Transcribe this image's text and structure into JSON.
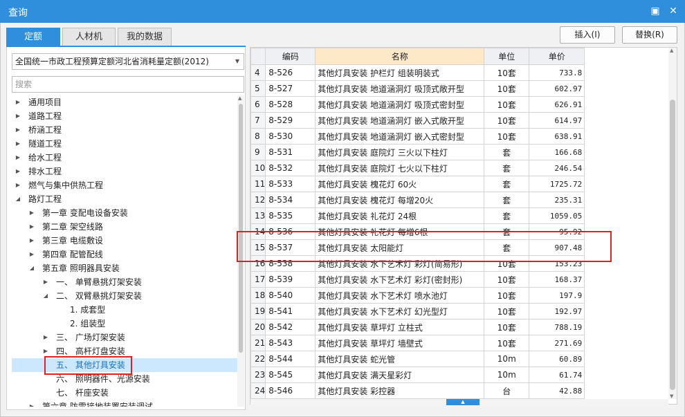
{
  "window": {
    "title": "查询",
    "restore_icon": "restore-icon",
    "close_icon": "close-icon"
  },
  "tabs": [
    {
      "label": "定额",
      "active": true
    },
    {
      "label": "人材机",
      "active": false
    },
    {
      "label": "我的数据",
      "active": false
    }
  ],
  "actions": {
    "insert_label": "插入(I)",
    "replace_label": "替换(R)"
  },
  "left": {
    "quota_select_value": "全国统一市政工程预算定额河北省消耗量定额(2012)",
    "search_placeholder": "搜索",
    "tree": [
      {
        "label": "通用项目",
        "level": 0,
        "state": "collapsed"
      },
      {
        "label": "道路工程",
        "level": 0,
        "state": "collapsed"
      },
      {
        "label": "桥涵工程",
        "level": 0,
        "state": "collapsed"
      },
      {
        "label": "隧道工程",
        "level": 0,
        "state": "collapsed"
      },
      {
        "label": "给水工程",
        "level": 0,
        "state": "collapsed"
      },
      {
        "label": "排水工程",
        "level": 0,
        "state": "collapsed"
      },
      {
        "label": "燃气与集中供热工程",
        "level": 0,
        "state": "collapsed"
      },
      {
        "label": "路灯工程",
        "level": 0,
        "state": "expanded"
      },
      {
        "label": "第一章 变配电设备安装",
        "level": 1,
        "state": "collapsed"
      },
      {
        "label": "第二章 架空线路",
        "level": 1,
        "state": "collapsed"
      },
      {
        "label": "第三章 电缆敷设",
        "level": 1,
        "state": "collapsed"
      },
      {
        "label": "第四章 配管配线",
        "level": 1,
        "state": "collapsed"
      },
      {
        "label": "第五章 照明器具安装",
        "level": 1,
        "state": "expanded"
      },
      {
        "label": "一、 单臂悬挑灯架安装",
        "level": 2,
        "state": "collapsed"
      },
      {
        "label": "二、 双臂悬挑灯架安装",
        "level": 2,
        "state": "expanded"
      },
      {
        "label": "1. 成套型",
        "level": 3,
        "state": "leaf"
      },
      {
        "label": "2. 组装型",
        "level": 3,
        "state": "leaf"
      },
      {
        "label": "三、 广场灯架安装",
        "level": 2,
        "state": "collapsed"
      },
      {
        "label": "四、 高杆灯盘安装",
        "level": 2,
        "state": "collapsed"
      },
      {
        "label": "五、 其他灯具安装",
        "level": 2,
        "state": "leaf",
        "selected": true
      },
      {
        "label": "六、 照明器件、光源安装",
        "level": 2,
        "state": "leaf"
      },
      {
        "label": "七、 杆座安装",
        "level": 2,
        "state": "leaf"
      },
      {
        "label": "第六章 防雷接地装置安装调试",
        "level": 1,
        "state": "collapsed"
      }
    ]
  },
  "grid": {
    "headers": {
      "num": "",
      "code": "编码",
      "name": "名称",
      "unit": "单位",
      "price": "单价"
    },
    "rows": [
      {
        "num": "4",
        "code": "8-526",
        "name": "其他灯具安装 护栏灯 组装明装式",
        "unit": "10套",
        "price": "733.8"
      },
      {
        "num": "5",
        "code": "8-527",
        "name": "其他灯具安装 地道涵洞灯 吸顶式敞开型",
        "unit": "10套",
        "price": "602.97"
      },
      {
        "num": "6",
        "code": "8-528",
        "name": "其他灯具安装 地道涵洞灯 吸顶式密封型",
        "unit": "10套",
        "price": "626.91"
      },
      {
        "num": "7",
        "code": "8-529",
        "name": "其他灯具安装 地道涵洞灯 嵌入式敞开型",
        "unit": "10套",
        "price": "614.97"
      },
      {
        "num": "8",
        "code": "8-530",
        "name": "其他灯具安装 地道涵洞灯 嵌入式密封型",
        "unit": "10套",
        "price": "638.91"
      },
      {
        "num": "9",
        "code": "8-531",
        "name": "其他灯具安装 庭院灯 三火以下柱灯",
        "unit": "套",
        "price": "166.68"
      },
      {
        "num": "10",
        "code": "8-532",
        "name": "其他灯具安装 庭院灯 七火以下柱灯",
        "unit": "套",
        "price": "246.54"
      },
      {
        "num": "11",
        "code": "8-533",
        "name": "其他灯具安装 槐花灯 60火",
        "unit": "套",
        "price": "1725.72"
      },
      {
        "num": "12",
        "code": "8-534",
        "name": "其他灯具安装 槐花灯 每增20火",
        "unit": "套",
        "price": "235.31"
      },
      {
        "num": "13",
        "code": "8-535",
        "name": "其他灯具安装 礼花灯 24根",
        "unit": "套",
        "price": "1059.05"
      },
      {
        "num": "14",
        "code": "8-536",
        "name": "其他灯具安装 礼花灯 每增6根",
        "unit": "套",
        "price": "95.92"
      },
      {
        "num": "15",
        "code": "8-537",
        "name": "其他灯具安装 太阳能灯",
        "unit": "套",
        "price": "907.48"
      },
      {
        "num": "16",
        "code": "8-538",
        "name": "其他灯具安装 水下艺术灯 彩灯(简易形)",
        "unit": "10套",
        "price": "153.23"
      },
      {
        "num": "17",
        "code": "8-539",
        "name": "其他灯具安装 水下艺术灯 彩灯(密封形)",
        "unit": "10套",
        "price": "168.37"
      },
      {
        "num": "18",
        "code": "8-540",
        "name": "其他灯具安装 水下艺术灯 喷水池灯",
        "unit": "10套",
        "price": "197.9"
      },
      {
        "num": "19",
        "code": "8-541",
        "name": "其他灯具安装 水下艺术灯 幻光型灯",
        "unit": "10套",
        "price": "192.97"
      },
      {
        "num": "20",
        "code": "8-542",
        "name": "其他灯具安装 草坪灯 立柱式",
        "unit": "10套",
        "price": "788.19"
      },
      {
        "num": "21",
        "code": "8-543",
        "name": "其他灯具安装 草坪灯 墙壁式",
        "unit": "10套",
        "price": "271.69"
      },
      {
        "num": "22",
        "code": "8-544",
        "name": "其他灯具安装 蛇光管",
        "unit": "10m",
        "price": "60.89"
      },
      {
        "num": "23",
        "code": "8-545",
        "name": "其他灯具安装 满天星彩灯",
        "unit": "10m",
        "price": "61.74"
      },
      {
        "num": "24",
        "code": "8-546",
        "name": "其他灯具安装 彩控器",
        "unit": "台",
        "price": "42.88"
      }
    ]
  },
  "colors": {
    "accent": "#2f8fdc",
    "highlight_box": "#e02020",
    "selected_row": "#cce8ff",
    "name_header": "#fde9c8"
  }
}
